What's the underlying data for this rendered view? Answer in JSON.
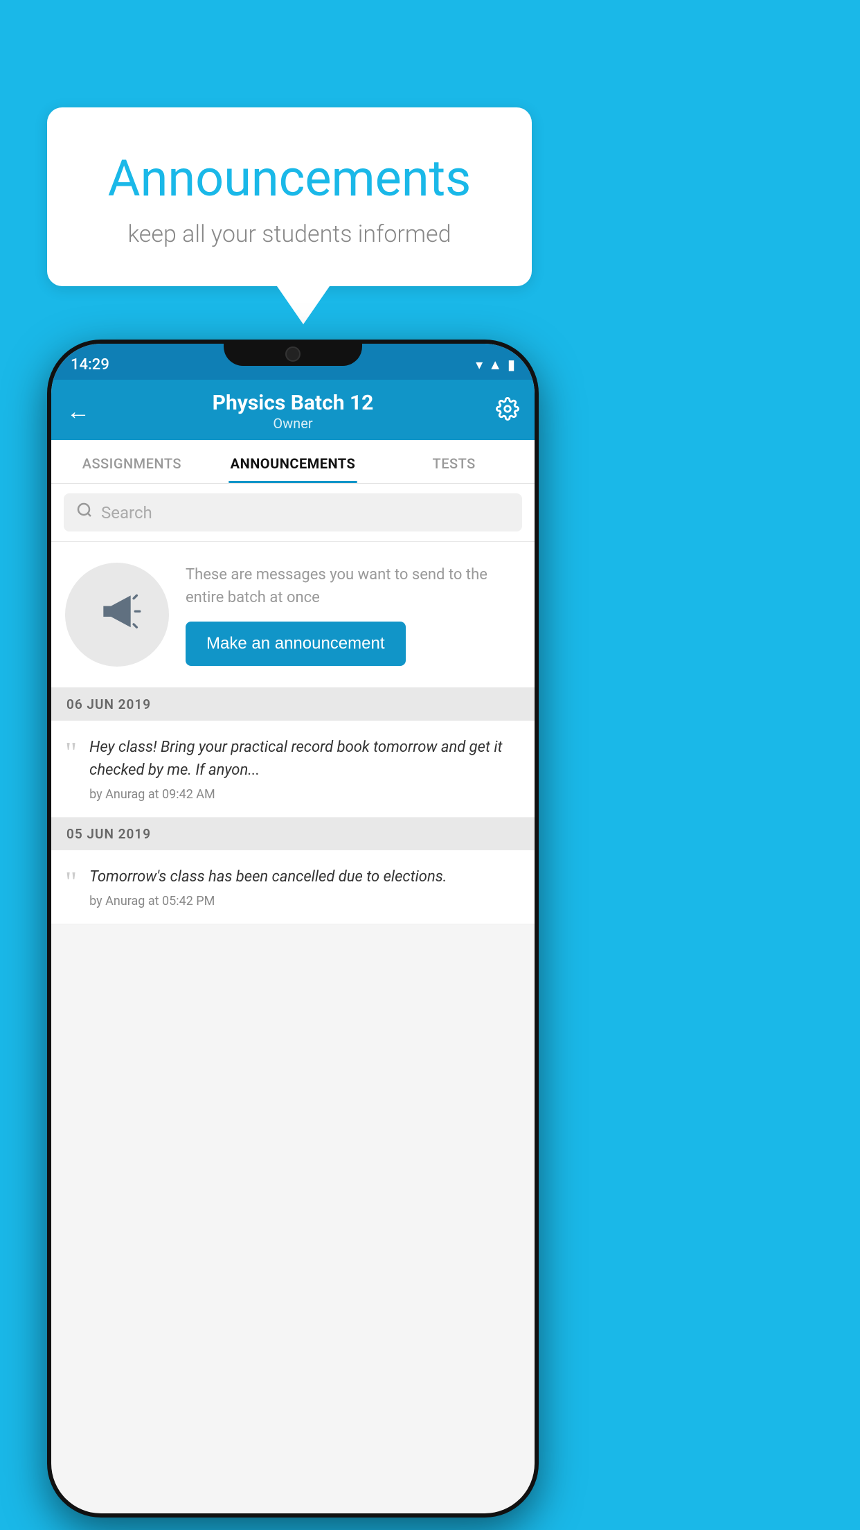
{
  "page": {
    "background_color": "#1ab8e8"
  },
  "speech_bubble": {
    "title": "Announcements",
    "subtitle": "keep all your students informed"
  },
  "phone": {
    "status_bar": {
      "time": "14:29",
      "wifi_icon": "wifi",
      "signal_icon": "signal",
      "battery_icon": "battery"
    },
    "header": {
      "back_label": "←",
      "title": "Physics Batch 12",
      "subtitle": "Owner",
      "settings_icon": "gear"
    },
    "tabs": [
      {
        "label": "ASSIGNMENTS",
        "active": false
      },
      {
        "label": "ANNOUNCEMENTS",
        "active": true
      },
      {
        "label": "TESTS",
        "active": false
      }
    ],
    "search": {
      "placeholder": "Search"
    },
    "cta": {
      "description": "These are messages you want to send to the entire batch at once",
      "button_label": "Make an announcement"
    },
    "announcements": [
      {
        "date": "06  JUN  2019",
        "message": "Hey class! Bring your practical record book tomorrow and get it checked by me. If anyon...",
        "author": "by Anurag at 09:42 AM"
      },
      {
        "date": "05  JUN  2019",
        "message": "Tomorrow's class has been cancelled due to elections.",
        "author": "by Anurag at 05:42 PM"
      }
    ]
  }
}
